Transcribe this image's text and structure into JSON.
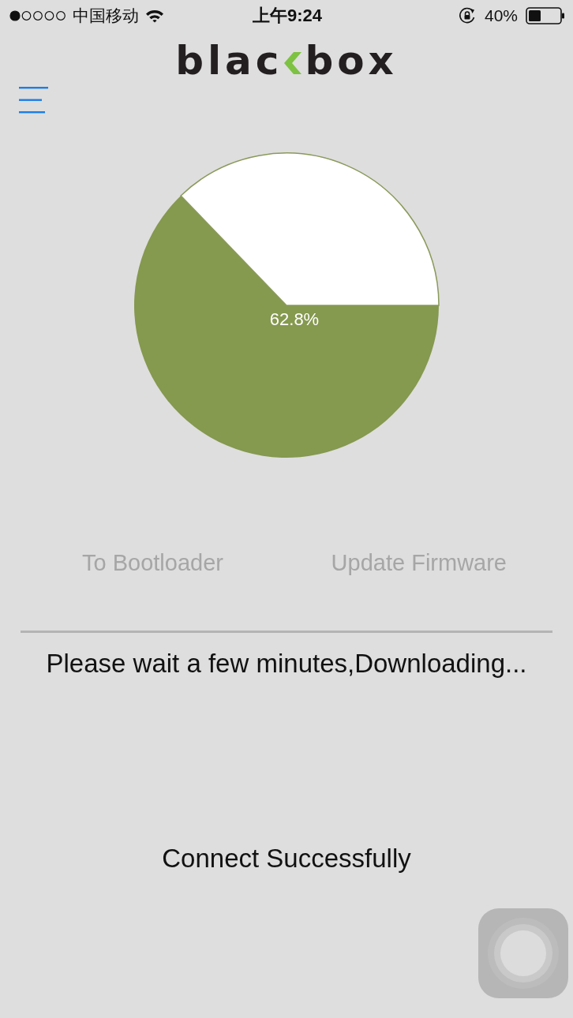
{
  "status_bar": {
    "carrier": "中国移动",
    "time": "上午9:24",
    "battery": "40%"
  },
  "header": {
    "logo": {
      "left": "blac",
      "right": "box"
    }
  },
  "progress": {
    "chart_data": {
      "type": "pie",
      "values": [
        62.8,
        37.2
      ],
      "value_labels": [
        "62.8%",
        null
      ]
    }
  },
  "actions": [
    {
      "label": "To Bootloader",
      "disabled": true
    },
    {
      "label": "Update Firmware",
      "disabled": true
    }
  ],
  "message": "Please wait a few minutes,Downloading...",
  "connection_status": "Connect Successfully"
}
